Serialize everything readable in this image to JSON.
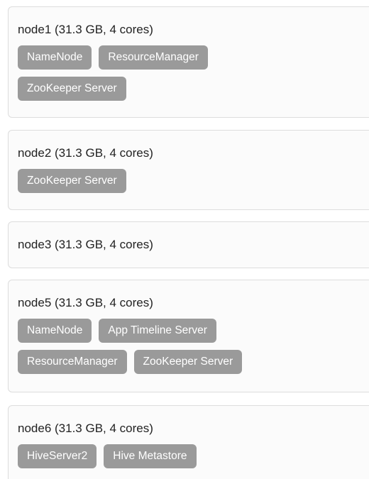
{
  "hosts": [
    {
      "title": "node1 (31.3 GB, 4 cores)",
      "components": [
        "NameNode",
        "ResourceManager",
        "ZooKeeper Server"
      ]
    },
    {
      "title": "node2 (31.3 GB, 4 cores)",
      "components": [
        "ZooKeeper Server"
      ]
    },
    {
      "title": "node3 (31.3 GB, 4 cores)",
      "components": []
    },
    {
      "title": "node5 (31.3 GB, 4 cores)",
      "components": [
        "NameNode",
        "App Timeline Server",
        "ResourceManager",
        "ZooKeeper Server"
      ]
    },
    {
      "title": "node6 (31.3 GB, 4 cores)",
      "components": [
        "HiveServer2",
        "Hive Metastore"
      ]
    }
  ]
}
